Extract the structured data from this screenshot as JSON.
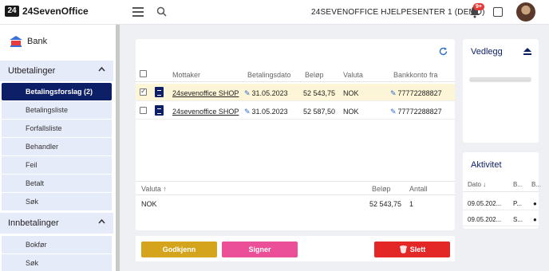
{
  "topbar": {
    "logo_mark": "24",
    "logo_text": "24SevenOffice",
    "company": "24SEVENOFFICE HJELPESENTER 1 (DEMO)",
    "notification_count": "9+"
  },
  "sidebar": {
    "header": "Bank",
    "groups": [
      {
        "label": "Utbetalinger",
        "items": [
          "Betalingsforslag (2)",
          "Betalingsliste",
          "Forfallsliste",
          "Behandler",
          "Feil",
          "Betalt",
          "Søk"
        ]
      },
      {
        "label": "Innbetalinger",
        "items": [
          "Bokfør",
          "Søk"
        ]
      }
    ]
  },
  "table": {
    "columns": [
      "Mottaker",
      "Betalingsdato",
      "Beløp",
      "Valuta",
      "Bankkonto fra"
    ],
    "rows": [
      {
        "mottaker": "24sevenoffice SHOP",
        "dato": "31.05.2023",
        "belop": "52 543,75",
        "valuta": "NOK",
        "konto": "77772288827",
        "checked": true
      },
      {
        "mottaker": "24sevenoffice SHOP",
        "dato": "31.05.2023",
        "belop": "52 587,50",
        "valuta": "NOK",
        "konto": "77772288827",
        "checked": false
      }
    ]
  },
  "summary": {
    "columns": [
      "Valuta",
      "Beløp",
      "Antall"
    ],
    "sort_indicator": "↑",
    "row": {
      "valuta": "NOK",
      "belop": "52 543,75",
      "antall": "1"
    }
  },
  "buttons": {
    "approve": "Godkjenn",
    "sign": "Signer",
    "delete": "Slett"
  },
  "vedlegg": {
    "title": "Vedlegg"
  },
  "aktivitet": {
    "title": "Aktivitet",
    "columns": [
      "Dato",
      "B...",
      "B..."
    ],
    "sort_indicator": "↓",
    "rows": [
      {
        "dato": "09.05.202...",
        "b1": "P...",
        "b2": ""
      },
      {
        "dato": "09.05.202...",
        "b1": "S...",
        "b2": ""
      }
    ]
  },
  "colors": {
    "brand_navy": "#0d1f66",
    "approve": "#d4a51c",
    "sign": "#ea4f98",
    "delete": "#e32626",
    "link_blue": "#2a6acb"
  }
}
